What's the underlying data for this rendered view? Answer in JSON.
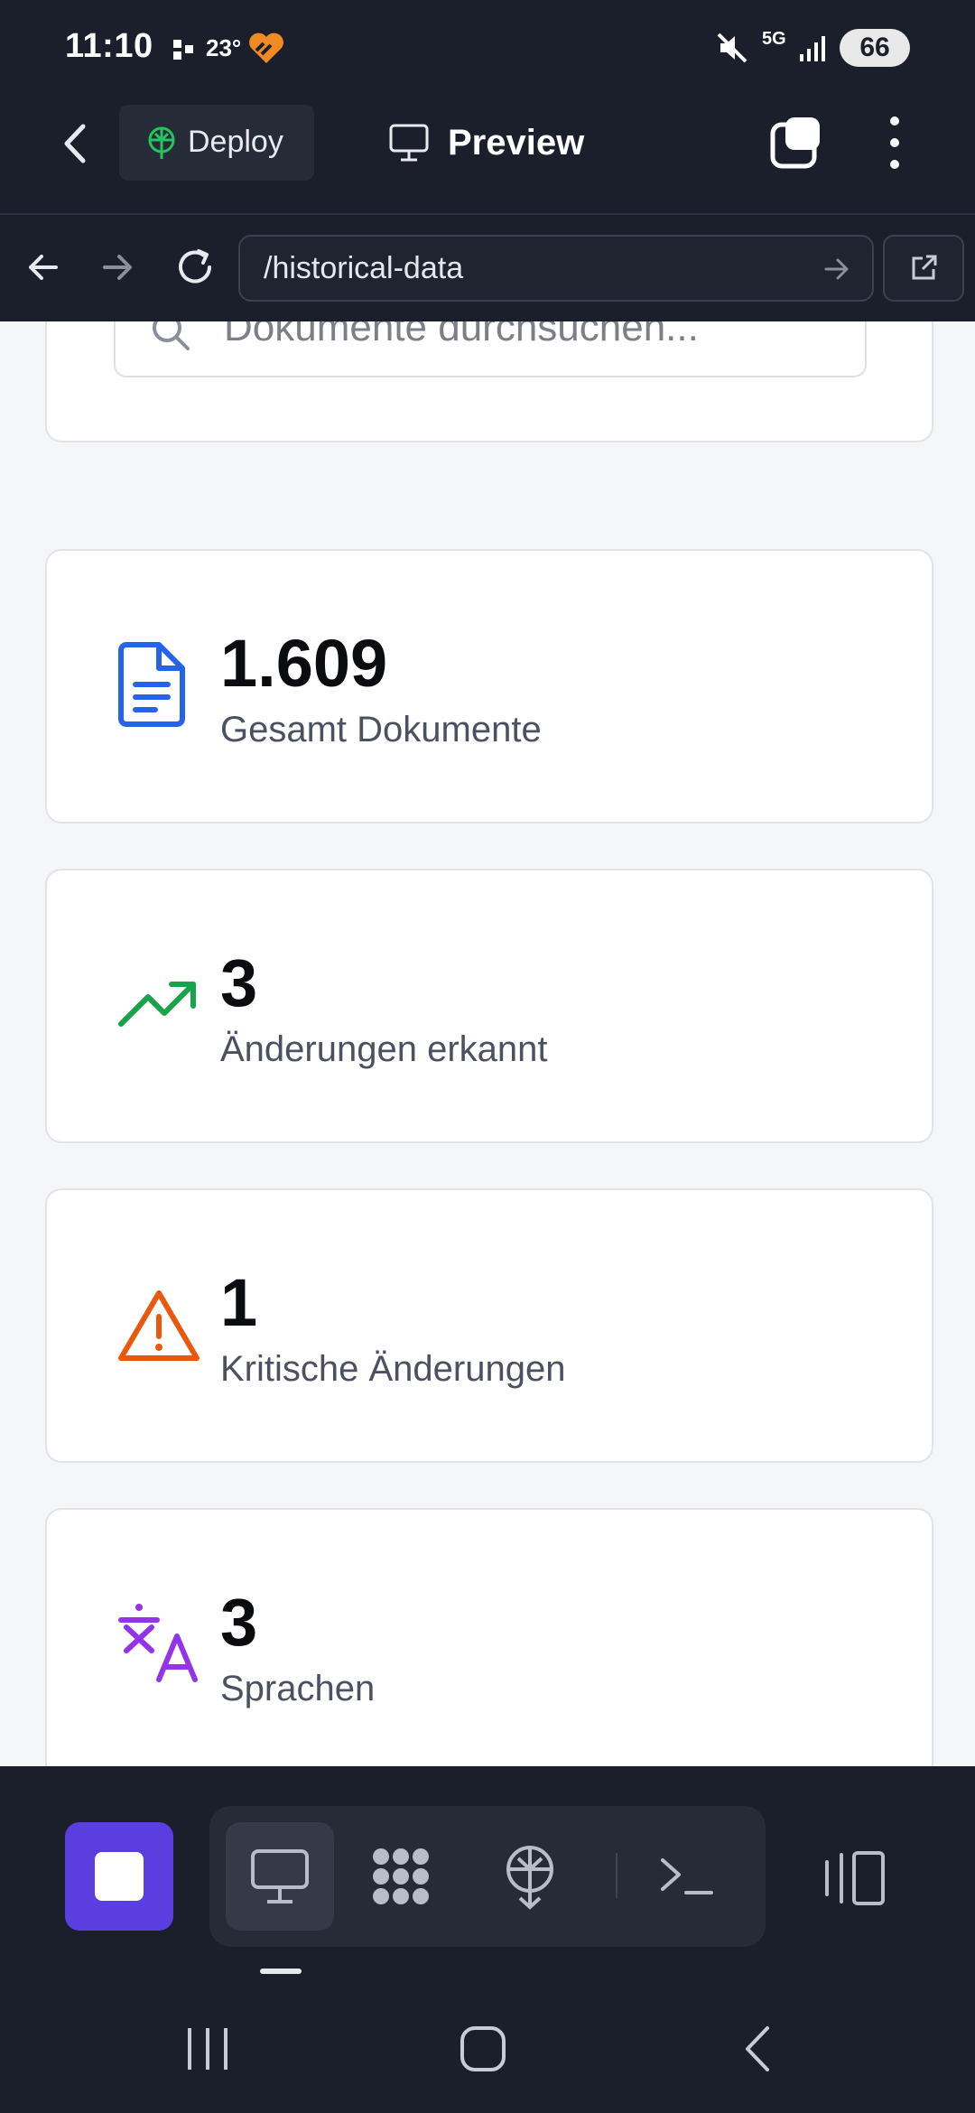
{
  "status_bar": {
    "time": "11:10",
    "temperature": "23°",
    "battery": "66",
    "network": "5G"
  },
  "app_bar": {
    "deploy_label": "Deploy",
    "preview_label": "Preview"
  },
  "browser": {
    "url": "/historical-data"
  },
  "search": {
    "placeholder": "Dokumente durchsuchen..."
  },
  "stats": [
    {
      "value": "1.609",
      "label": "Gesamt Dokumente",
      "icon": "document-icon",
      "color": "#2563eb"
    },
    {
      "value": "3",
      "label": "Änderungen erkannt",
      "icon": "trending-up-icon",
      "color": "#16a34a"
    },
    {
      "value": "1",
      "label": "Kritische Änderungen",
      "icon": "warning-icon",
      "color": "#ea580c"
    },
    {
      "value": "3",
      "label": "Sprachen",
      "icon": "translate-icon",
      "color": "#9333ea"
    }
  ],
  "colors": {
    "dark_bg": "#1b1f2b",
    "accent": "#5b3ee0"
  }
}
